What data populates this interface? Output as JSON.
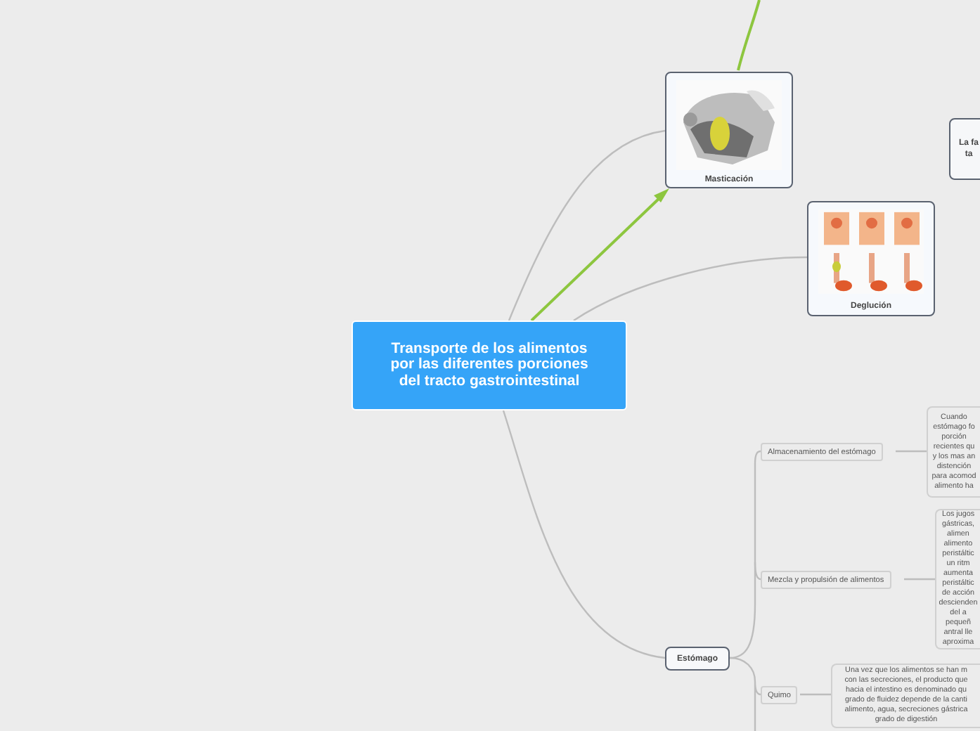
{
  "central_topic": {
    "title": "Transporte de los alimentos por las diferentes porciones del tracto gastrointestinal"
  },
  "topics": [
    {
      "label": "Masticación"
    },
    {
      "label": "Deglución"
    },
    {
      "kind": "text",
      "lines": [
        "La fa",
        "ta"
      ]
    },
    {
      "kind": "text",
      "lines": [
        "Estómago"
      ],
      "children": [
        {
          "label": "Almacenamiento del estómago",
          "note": [
            "Cuando",
            "estómago fo",
            "porción",
            "recientes qu",
            "y los mas an",
            "distención",
            "para acomod",
            "alimento ha"
          ]
        },
        {
          "label": "Mezcla y propulsión de alimentos",
          "note": [
            "Los jugos",
            "gástricas,",
            "alimen",
            "alimento",
            "peristáltic",
            "un ritm",
            "aumenta",
            "peristáltic",
            "de acción",
            "descienden",
            "del a",
            "pequeñ",
            "antral lle",
            "aproxima"
          ]
        },
        {
          "label": "Quimo",
          "note": [
            "Una vez que los alimentos se han m",
            "con las secreciones, el producto que",
            "hacia el intestino es denominado qu",
            "grado de fluidez depende de la canti",
            "alimento, agua, secreciones gástrica",
            "grado de digestión"
          ]
        }
      ]
    }
  ]
}
